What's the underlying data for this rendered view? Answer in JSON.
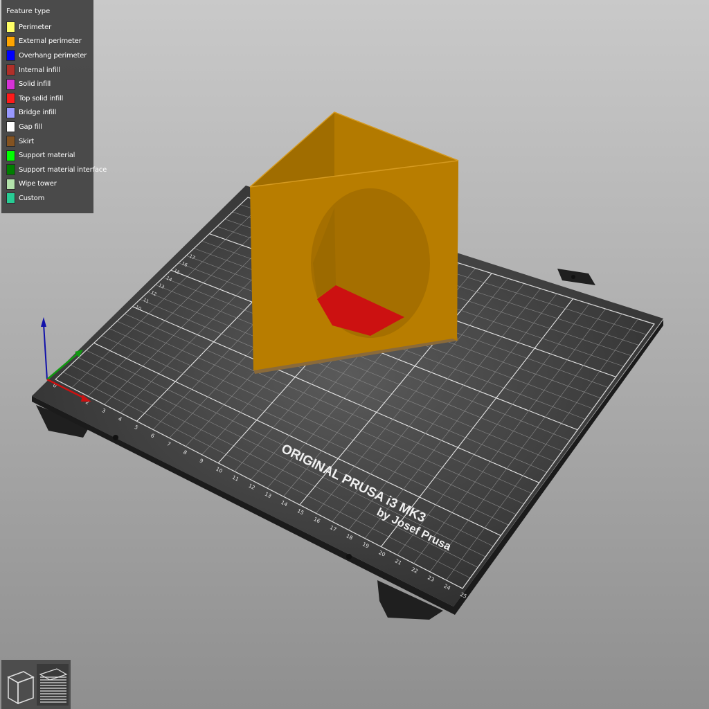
{
  "legend": {
    "title": "Feature type",
    "items": [
      {
        "label": "Perimeter",
        "color": "#ffff66"
      },
      {
        "label": "External perimeter",
        "color": "#ffa500"
      },
      {
        "label": "Overhang perimeter",
        "color": "#0000ff"
      },
      {
        "label": "Internal infill",
        "color": "#b03029"
      },
      {
        "label": "Solid infill",
        "color": "#d732d7"
      },
      {
        "label": "Top solid infill",
        "color": "#ff1a1a"
      },
      {
        "label": "Bridge infill",
        "color": "#9999ff"
      },
      {
        "label": "Gap fill",
        "color": "#ffffff"
      },
      {
        "label": "Skirt",
        "color": "#845321"
      },
      {
        "label": "Support material",
        "color": "#00ff00"
      },
      {
        "label": "Support material interface",
        "color": "#008000"
      },
      {
        "label": "Wipe tower",
        "color": "#b3e3ab"
      },
      {
        "label": "Custom",
        "color": "#28cc94"
      }
    ]
  },
  "bed": {
    "logo_line1": "ORIGINAL PRUSA i3 MK3",
    "logo_line2": "by Josef Prusa",
    "x_ticks": [
      "0",
      "2",
      "3",
      "4",
      "5",
      "6",
      "7",
      "8",
      "9",
      "10",
      "11",
      "12",
      "13",
      "14",
      "15",
      "16",
      "17",
      "18",
      "19",
      "20",
      "21",
      "22",
      "23",
      "24",
      "25"
    ],
    "y_ticks": [
      "10",
      "11",
      "12",
      "13",
      "14",
      "15",
      "16",
      "17"
    ]
  },
  "view_toggle": {
    "items": [
      {
        "name": "3d-view",
        "icon": "cube-icon",
        "active": false
      },
      {
        "name": "preview-layers",
        "icon": "layers-icon",
        "active": true
      }
    ]
  },
  "colors": {
    "model_wall": "#b37a00",
    "model_wall_dark": "#a06d00",
    "top_infill": "#cc1111",
    "bed_plate": "#2e2e2e",
    "axis_x": "#cc1111",
    "axis_y": "#119911",
    "axis_z": "#1111aa"
  }
}
